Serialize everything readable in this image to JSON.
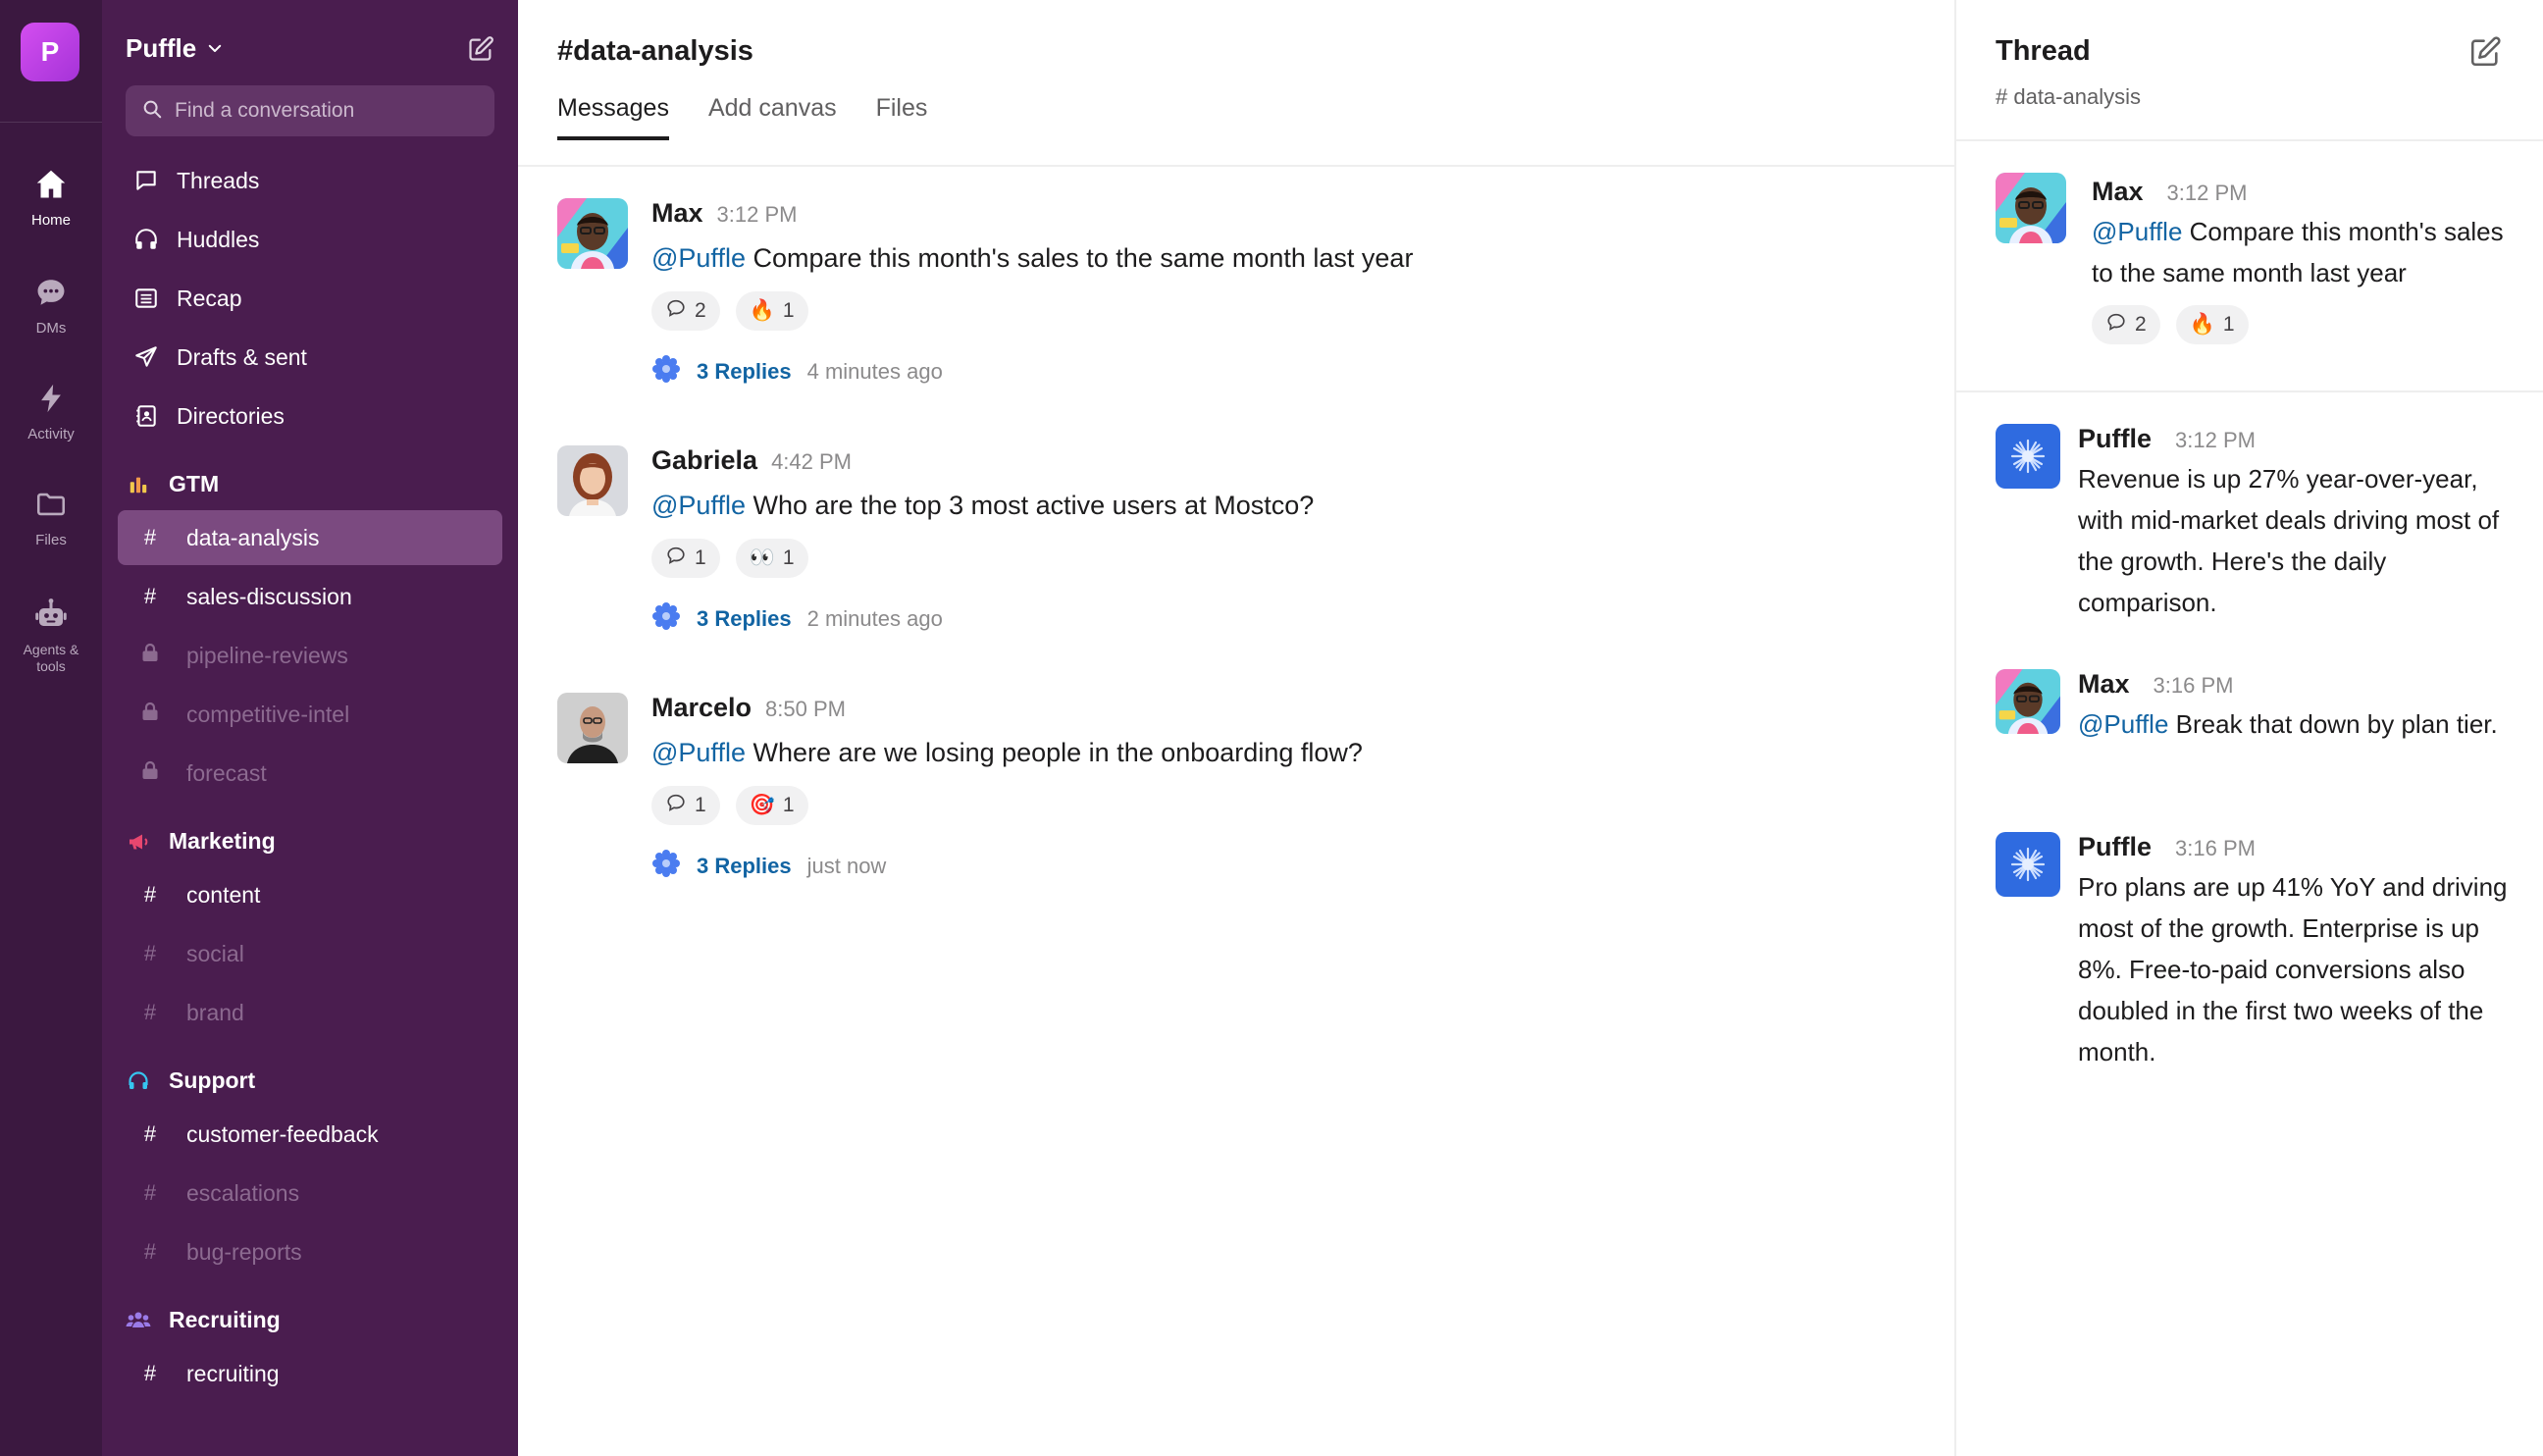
{
  "workspace": {
    "initial": "P",
    "name": "Puffle"
  },
  "rail": [
    {
      "label": "Home",
      "icon": "home-icon"
    },
    {
      "label": "DMs",
      "icon": "chat-bubble-icon"
    },
    {
      "label": "Activity",
      "icon": "lightning-icon"
    },
    {
      "label": "Files",
      "icon": "folder-icon"
    },
    {
      "label": "Agents & tools",
      "icon": "robot-icon"
    }
  ],
  "search": {
    "placeholder": "Find a conversation"
  },
  "nav": [
    {
      "label": "Threads",
      "icon": "threads-icon"
    },
    {
      "label": "Huddles",
      "icon": "headphones-icon"
    },
    {
      "label": "Recap",
      "icon": "list-icon"
    },
    {
      "label": "Drafts & sent",
      "icon": "send-icon"
    },
    {
      "label": "Directories",
      "icon": "directory-icon"
    }
  ],
  "sections": {
    "gtm": {
      "label": "GTM",
      "channels": [
        {
          "name": "data-analysis"
        },
        {
          "name": "sales-discussion"
        },
        {
          "name": "pipeline-reviews"
        },
        {
          "name": "competitive-intel"
        },
        {
          "name": "forecast"
        }
      ]
    },
    "marketing": {
      "label": "Marketing",
      "channels": [
        {
          "name": "content"
        },
        {
          "name": "social"
        },
        {
          "name": "brand"
        }
      ]
    },
    "support": {
      "label": "Support",
      "channels": [
        {
          "name": "customer-feedback"
        },
        {
          "name": "escalations"
        },
        {
          "name": "bug-reports"
        }
      ]
    },
    "recruiting": {
      "label": "Recruiting",
      "channels": [
        {
          "name": "recruiting"
        }
      ]
    }
  },
  "channel": {
    "title": "#data-analysis",
    "tabs": [
      "Messages",
      "Add canvas",
      "Files"
    ]
  },
  "messages": [
    {
      "author": "Max",
      "time": "3:12 PM",
      "mention": "@Puffle",
      "text": "Compare this month's sales to the same month last year",
      "reactions": [
        {
          "emoji": "💬",
          "count": "2"
        },
        {
          "emoji": "🔥",
          "count": "1"
        }
      ],
      "replies": "3 Replies",
      "ago": "4 minutes ago"
    },
    {
      "author": "Gabriela",
      "time": "4:42 PM",
      "mention": "@Puffle",
      "text": "Who are the top 3 most active users at Mostco?",
      "reactions": [
        {
          "emoji": "💬",
          "count": "1"
        },
        {
          "emoji": "👀",
          "count": "1"
        }
      ],
      "replies": "3 Replies",
      "ago": "2 minutes ago"
    },
    {
      "author": "Marcelo",
      "time": "8:50 PM",
      "mention": "@Puffle",
      "text": "Where are we losing people in the onboarding flow?",
      "reactions": [
        {
          "emoji": "💬",
          "count": "1"
        },
        {
          "emoji": "🎯",
          "count": "1"
        }
      ],
      "replies": "3 Replies",
      "ago": "just now"
    }
  ],
  "thread": {
    "title": "Thread",
    "channel": "# data-analysis",
    "parent": {
      "author": "Max",
      "time": "3:12 PM",
      "mention": "@Puffle",
      "text": "Compare this month's sales to the same month last year",
      "reactions": [
        {
          "emoji": "💬",
          "count": "2"
        },
        {
          "emoji": "🔥",
          "count": "1"
        }
      ]
    },
    "replies": [
      {
        "author": "Puffle",
        "time": "3:12 PM",
        "text": "Revenue is up 27% year-over-year, with mid-market deals driving most of the growth. Here's the daily comparison."
      },
      {
        "author": "Max",
        "time": "3:16 PM",
        "mention": "@Puffle",
        "text": "Break that down by plan tier."
      },
      {
        "author": "Puffle",
        "time": "3:16 PM",
        "text": "Pro plans are up 41% YoY and driving most of the growth. Enterprise is up 8%. Free-to-paid conversions also doubled in the first two weeks of the month."
      }
    ]
  },
  "colors": {
    "rail": "#3b1840",
    "sidebar": "#4a1d4f",
    "active_channel": "#7b4a80",
    "mention": "#1264a3",
    "bot": "#2f6be0"
  }
}
